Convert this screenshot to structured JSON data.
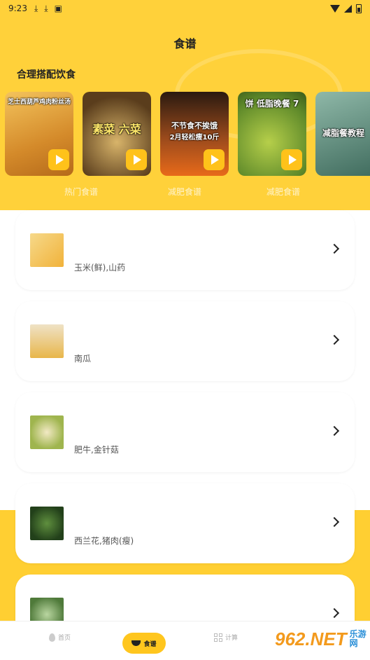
{
  "status_bar": {
    "time": "9:23",
    "notif_icons": [
      "download-icon",
      "download-icon",
      "app-icon"
    ],
    "right_icons": [
      "wifi-icon",
      "signal-icon",
      "battery-icon"
    ]
  },
  "header": {
    "title": "食谱"
  },
  "section": {
    "title": "合理搭配饮食"
  },
  "carousel": {
    "cards": [
      {
        "caption": "芝士西葫芦鸡肉粉丝汤",
        "bg": "#e8b14a"
      },
      {
        "caption": "素菜 六菜",
        "bg": "#7a5a2c"
      },
      {
        "caption": "不节食不挨饿",
        "caption2": "2月轻松瘦10斤",
        "bg": "#8a3a1c"
      },
      {
        "caption": "饼 低脂晚餐 7",
        "bg": "#7aa638"
      },
      {
        "caption": "减脂餐教程",
        "bg": "#5a8a7a"
      }
    ],
    "category_labels": [
      "热门食谱",
      "减肥食谱",
      "减肥食谱"
    ]
  },
  "recipes": [
    {
      "ingredients": "玉米(鲜),山药",
      "thumb_color": "#f1c05a"
    },
    {
      "ingredients": "南瓜",
      "thumb_color": "#e9c06b"
    },
    {
      "ingredients": "肥牛,金针菇",
      "thumb_color": "#c8c77a"
    },
    {
      "ingredients": "西兰花,猪肉(瘦)",
      "thumb_color": "#3f6b32"
    },
    {
      "ingredients": "",
      "thumb_color": "#6a8f5a"
    }
  ],
  "tab_bar": {
    "home": "首页",
    "recipes": "食谱",
    "calculate": "计算"
  },
  "watermark": {
    "logo": "962.NET",
    "sub": "乐游网"
  },
  "colors": {
    "brand_yellow": "#ffd13a",
    "play_button": "#ffc21a"
  }
}
